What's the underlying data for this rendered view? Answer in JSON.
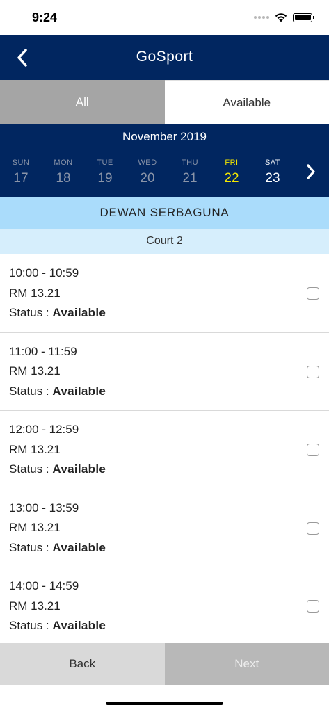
{
  "status_bar": {
    "time": "9:24"
  },
  "header": {
    "title": "GoSport",
    "back_icon": "chevron-left-icon"
  },
  "filter_tabs": [
    {
      "label": "All",
      "selected": true
    },
    {
      "label": "Available",
      "selected": false
    }
  ],
  "calendar": {
    "month": "November 2019",
    "days": [
      {
        "name": "SUN",
        "num": "17"
      },
      {
        "name": "MON",
        "num": "18"
      },
      {
        "name": "TUE",
        "num": "19"
      },
      {
        "name": "WED",
        "num": "20"
      },
      {
        "name": "THU",
        "num": "21"
      },
      {
        "name": "FRI",
        "num": "22"
      },
      {
        "name": "SAT",
        "num": "23"
      }
    ],
    "next_icon": "chevron-right-icon",
    "highlight_color": "#f3e700"
  },
  "venue": "DEWAN SERBAGUNA",
  "court": "Court 2",
  "slots": [
    {
      "time": "10:00 - 10:59",
      "price": "RM 13.21",
      "status_label": "Status :",
      "status": "Available",
      "checked": false
    },
    {
      "time": "11:00 - 11:59",
      "price": "RM 13.21",
      "status_label": "Status :",
      "status": "Available",
      "checked": false
    },
    {
      "time": "12:00 - 12:59",
      "price": "RM 13.21",
      "status_label": "Status :",
      "status": "Available",
      "checked": false
    },
    {
      "time": "13:00 - 13:59",
      "price": "RM 13.21",
      "status_label": "Status :",
      "status": "Available",
      "checked": false
    },
    {
      "time": "14:00 - 14:59",
      "price": "RM 13.21",
      "status_label": "Status :",
      "status": "Available",
      "checked": false
    }
  ],
  "buttons": {
    "back": "Back",
    "next": "Next"
  },
  "colors": {
    "brand": "#012660",
    "venue_bg": "#aadcfb",
    "court_bg": "#d6eefc"
  }
}
